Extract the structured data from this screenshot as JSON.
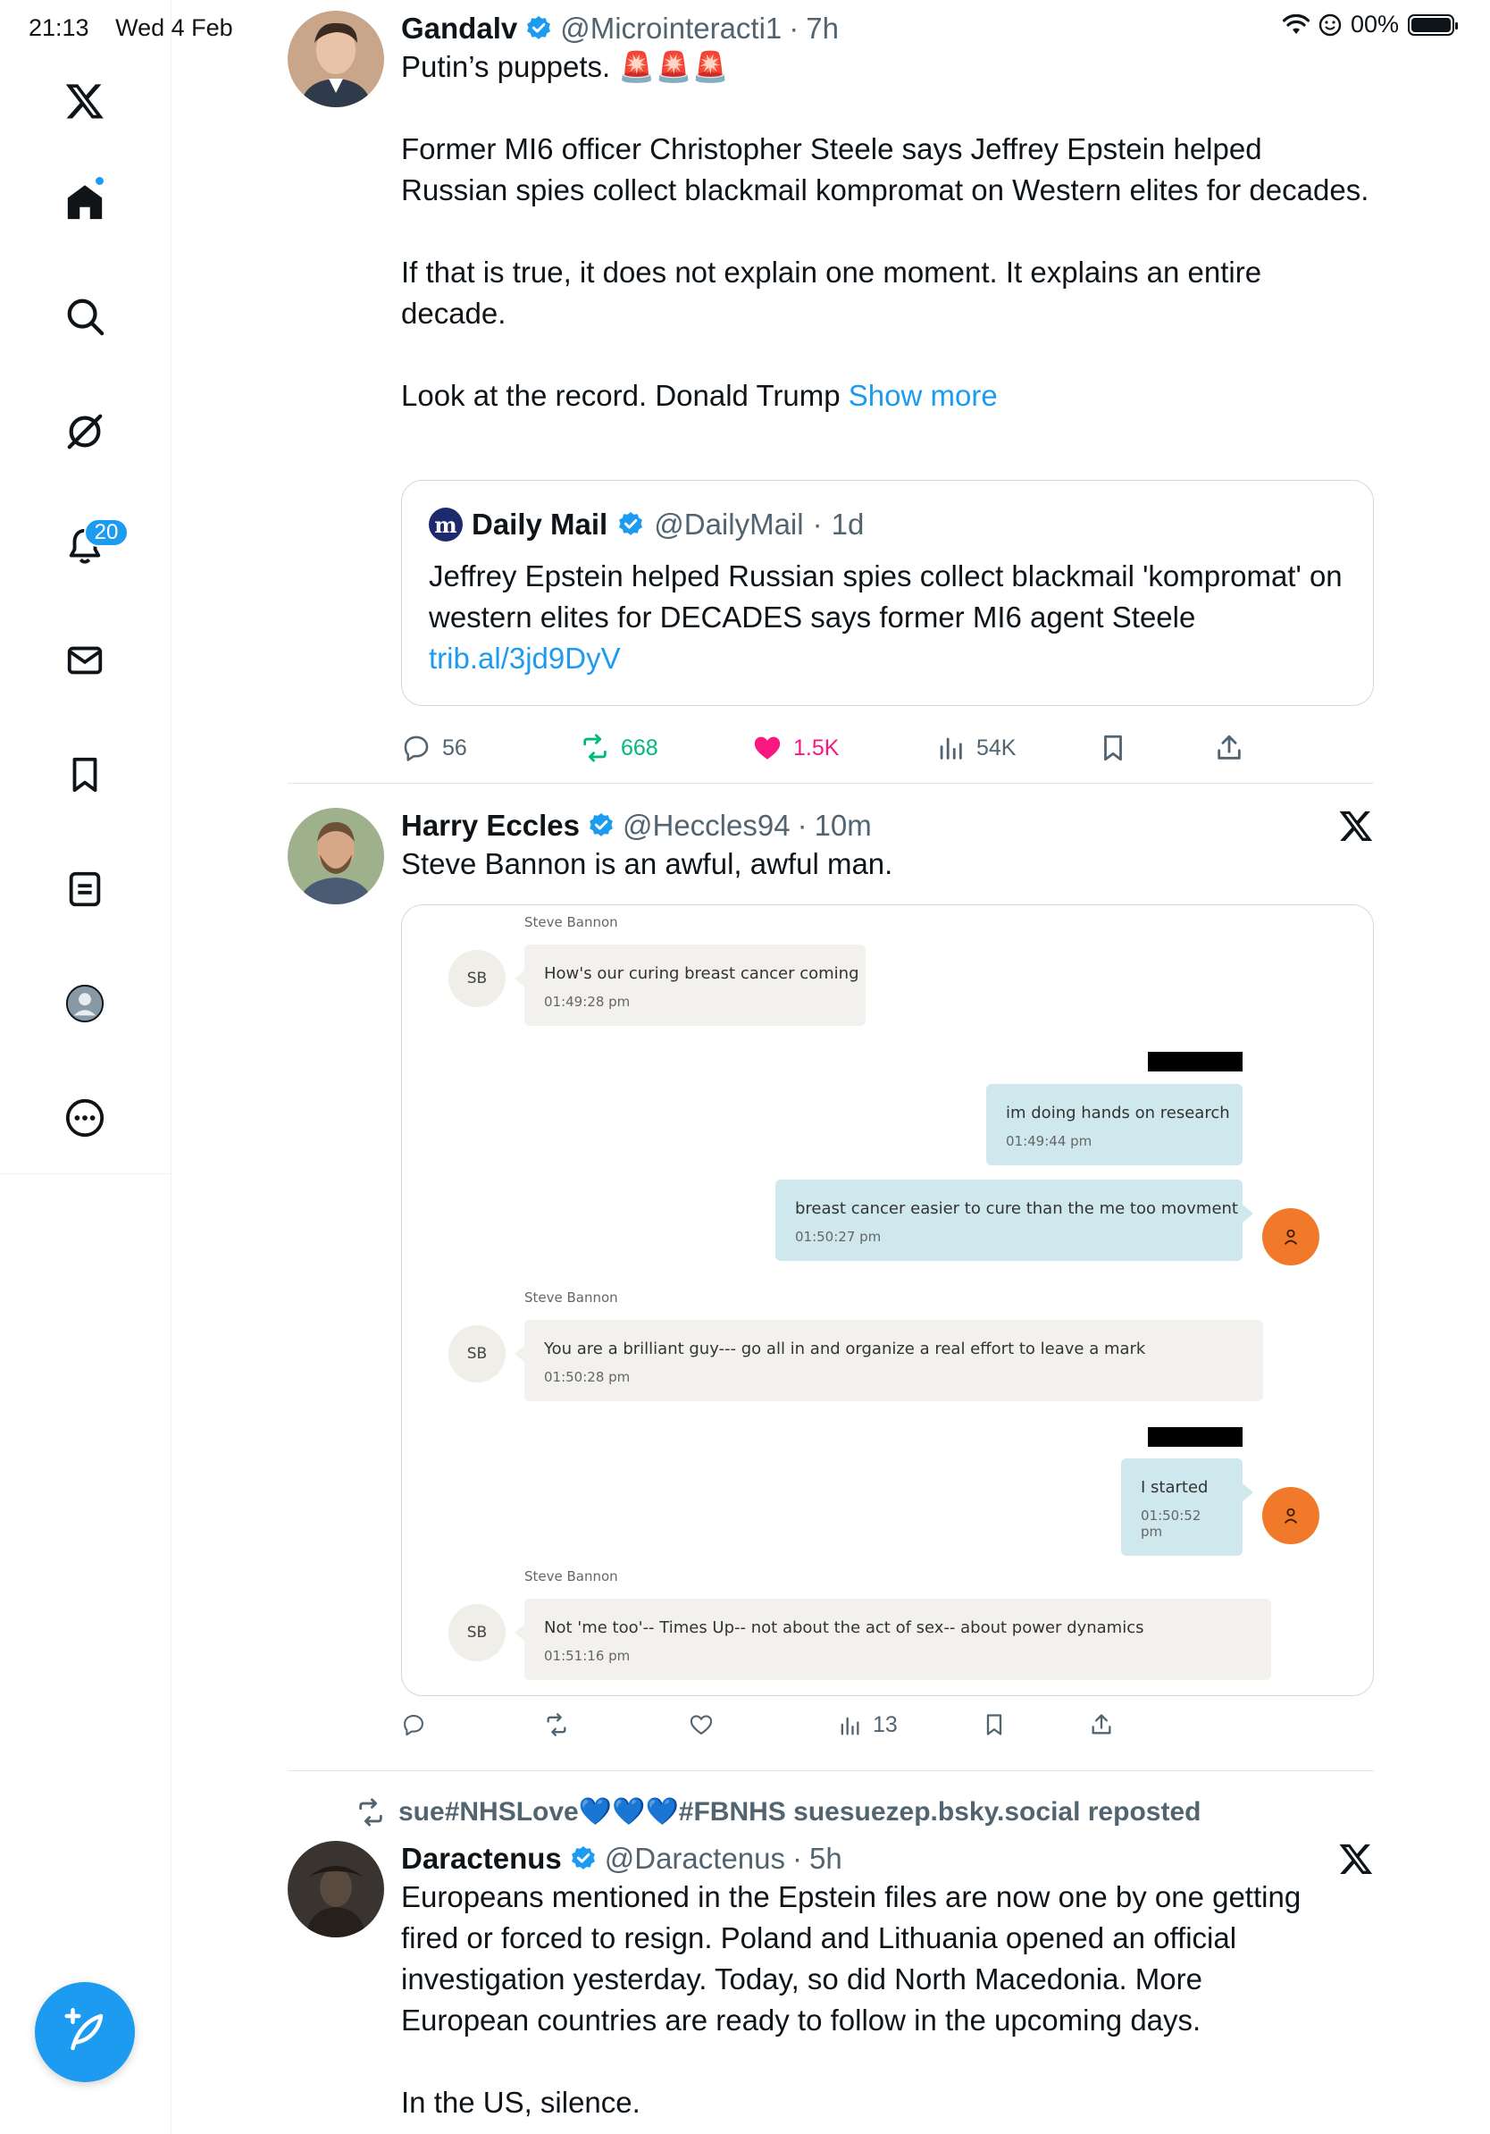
{
  "status_bar": {
    "time": "21:13",
    "date": "Wed 4 Feb",
    "battery": "00%"
  },
  "sidebar": {
    "items": [
      {
        "name": "x-logo"
      },
      {
        "name": "home"
      },
      {
        "name": "search"
      },
      {
        "name": "grok"
      },
      {
        "name": "notifications",
        "badge": "20"
      },
      {
        "name": "messages"
      },
      {
        "name": "bookmarks"
      },
      {
        "name": "lists"
      },
      {
        "name": "profile"
      },
      {
        "name": "more"
      }
    ]
  },
  "tweets": [
    {
      "name": "Gandalv",
      "handle": "@Microinteracti1",
      "time": "7h",
      "text_lines": [
        "Putin’s puppets. 🚨🚨🚨",
        "Former MI6 officer Christopher Steele says Jeffrey Epstein helped Russian spies collect blackmail kompromat on Western elites for decades.",
        "If that is true, it does not explain one moment. It explains an entire decade.",
        "Look at the record. Donald Trump"
      ],
      "show_more": "Show more",
      "quote": {
        "name": "Daily Mail",
        "handle": "@DailyMail",
        "time": "1d",
        "logo": "m",
        "text": "Jeffrey Epstein helped Russian spies collect blackmail 'kompromat' on western elites for DECADES says former MI6 agent Steele",
        "link": "trib.al/3jd9DyV"
      },
      "stats": {
        "replies": "56",
        "reposts": "668",
        "likes": "1.5K",
        "views": "54K"
      }
    },
    {
      "name": "Harry Eccles",
      "handle": "@Heccles94",
      "time": "10m",
      "text": "Steve Bannon is an awful, awful man.",
      "chat": {
        "sender": "Steve Bannon",
        "avatar": "SB",
        "messages": [
          {
            "text": "How's our curing breast cancer coming",
            "time": "01:49:28 pm"
          },
          {
            "text": "im doing hands on research",
            "time": "01:49:44 pm"
          },
          {
            "text": "breast cancer easier to cure than the me too movment",
            "time": "01:50:27 pm"
          },
          {
            "text": "You are a brilliant guy--- go all in and organize a real effort to leave a mark",
            "time": "01:50:28 pm"
          },
          {
            "text": "I started",
            "time": "01:50:52 pm"
          },
          {
            "text": "Not 'me too'-- Times Up-- not about the act of sex-- about power dynamics",
            "time": "01:51:16 pm"
          }
        ]
      },
      "stats": {
        "views": "13"
      }
    },
    {
      "repost_by": "sue#NHSLove💙💙💙#FBNHS suesuezep.bsky.social reposted",
      "name": "Daractenus",
      "handle": "@Daractenus",
      "time": "5h",
      "text_lines": [
        "Europeans mentioned in the Epstein files are now one by one getting fired or forced to resign. Poland and Lithuania opened an official investigation yesterday. Today, so did North Macedonia. More European countries are ready to follow in the upcoming days.",
        "In the US, silence."
      ]
    }
  ],
  "colors": {
    "accent": "#1d9bf0",
    "like": "#f91880",
    "repost": "#00ba7c",
    "secondary_text": "#536471"
  }
}
